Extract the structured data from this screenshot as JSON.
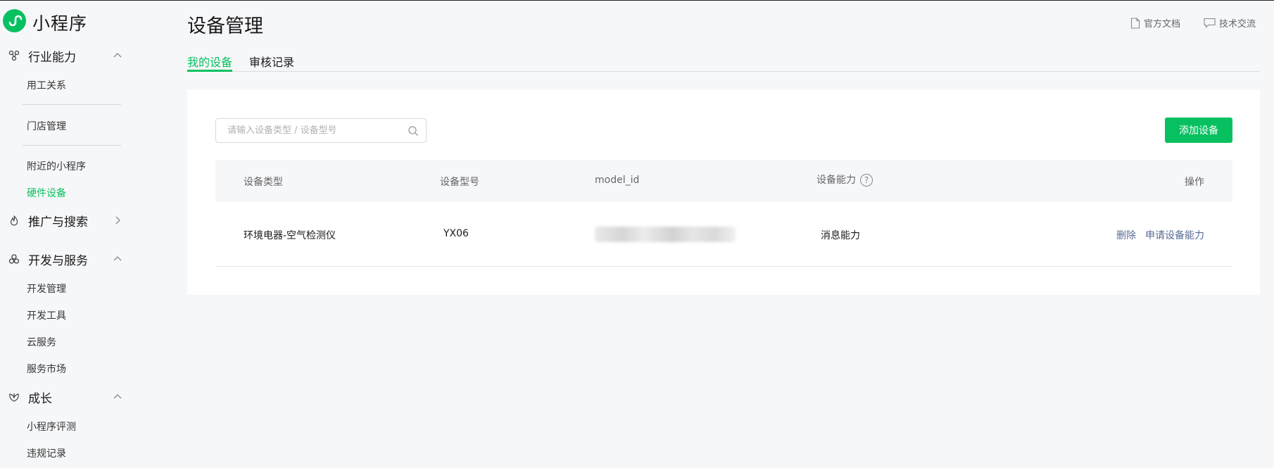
{
  "app": {
    "title": "小程序"
  },
  "sidebar": {
    "sections": [
      {
        "label": "行业能力",
        "icon": "industry-icon",
        "expanded": true
      },
      {
        "label": "推广与搜索",
        "icon": "promotion-icon",
        "expanded": false
      },
      {
        "label": "开发与服务",
        "icon": "dev-service-icon",
        "expanded": true
      },
      {
        "label": "成长",
        "icon": "growth-icon",
        "expanded": true
      }
    ],
    "items": {
      "employment": "用工关系",
      "store": "门店管理",
      "nearby": "附近的小程序",
      "hardware": "硬件设备",
      "dev_manage": "开发管理",
      "dev_tools": "开发工具",
      "cloud": "云服务",
      "market": "服务市场",
      "review": "小程序评测",
      "violation": "违规记录"
    }
  },
  "header": {
    "title": "设备管理",
    "links": {
      "docs": "官方文档",
      "community": "技术交流"
    }
  },
  "tabs": {
    "mine": "我的设备",
    "audit": "审核记录"
  },
  "toolbar": {
    "search_placeholder": "请输入设备类型 / 设备型号",
    "add_label": "添加设备"
  },
  "table": {
    "headers": {
      "type": "设备类型",
      "model": "设备型号",
      "model_id": "model_id",
      "capability": "设备能力",
      "action": "操作"
    },
    "rows": [
      {
        "type": "环境电器-空气检测仪",
        "model": "YX06",
        "capability": "消息能力",
        "delete": "删除",
        "apply": "申请设备能力"
      }
    ]
  },
  "colors": {
    "accent": "#07c160",
    "link": "#576b95"
  }
}
